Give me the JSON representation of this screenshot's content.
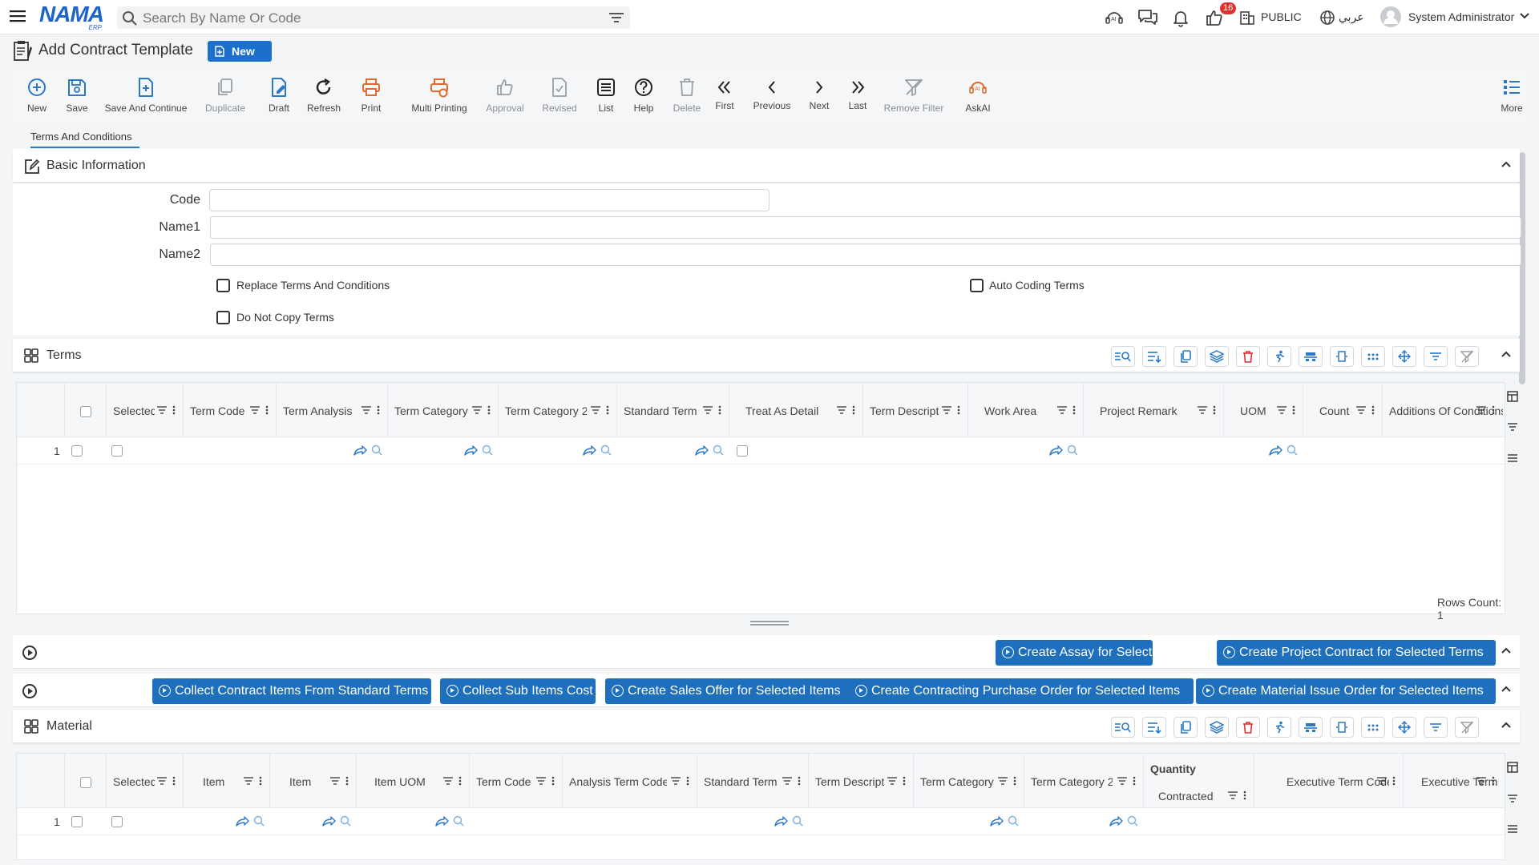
{
  "header": {
    "logo_text": "NAMA",
    "logo_sub": "ERP",
    "search_placeholder": "Search By Name Or Code",
    "notification_count": "16",
    "public_label": "PUBLIC",
    "language_label": "عربي",
    "user_name": "System Administrator"
  },
  "page": {
    "title": "Add Contract Template",
    "status_badge": "New"
  },
  "toolbar": {
    "items": [
      {
        "label": "New",
        "icon": "plus-circle-icon"
      },
      {
        "label": "Save",
        "icon": "save-icon"
      },
      {
        "label": "Save And Continue",
        "icon": "save-continue-icon"
      },
      {
        "label": "Duplicate",
        "icon": "duplicate-icon"
      },
      {
        "label": "Draft",
        "icon": "draft-icon"
      },
      {
        "label": "Refresh",
        "icon": "refresh-icon"
      },
      {
        "label": "Print",
        "icon": "print-icon"
      },
      {
        "label": "Multi Printing",
        "icon": "multi-print-icon"
      },
      {
        "label": "Approval",
        "icon": "thumbs-up-icon"
      },
      {
        "label": "Revised",
        "icon": "revised-icon"
      },
      {
        "label": "List",
        "icon": "list-icon"
      },
      {
        "label": "Help",
        "icon": "help-icon"
      },
      {
        "label": "Delete",
        "icon": "trash-icon"
      },
      {
        "label": "First",
        "icon": "first-icon"
      },
      {
        "label": "Previous",
        "icon": "previous-icon"
      },
      {
        "label": "Next",
        "icon": "next-icon"
      },
      {
        "label": "Last",
        "icon": "last-icon"
      },
      {
        "label": "Remove Filter",
        "icon": "remove-filter-icon"
      },
      {
        "label": "AskAI",
        "icon": "ai-icon"
      },
      {
        "label": "More",
        "icon": "more-icon"
      }
    ]
  },
  "tabs": {
    "active": "Terms And Conditions"
  },
  "basic_info": {
    "title": "Basic Information",
    "code_label": "Code",
    "code_value": "",
    "name1_label": "Name1",
    "name1_value": "",
    "name2_label": "Name2",
    "name2_value": "",
    "replace_terms": "Replace Terms And Conditions",
    "auto_coding": "Auto Coding Terms",
    "do_not_copy": "Do Not Copy Terms"
  },
  "terms": {
    "title": "Terms",
    "columns": [
      "Selected",
      "Term Code",
      "Term Analysis",
      "Term Category",
      "Term Category 2",
      "Standard Term",
      "Treat As Detail",
      "Term Description",
      "Work Area",
      "Project Remark",
      "UOM",
      "Count",
      "Additions Of Conditions"
    ],
    "row_number": "1",
    "rows_count_label": "Rows Count: 1"
  },
  "terms_actions": {
    "create_assay": "Create Assay for Selected Terms",
    "create_project_contract": "Create Project Contract for Selected Terms"
  },
  "item_actions": {
    "collect_contract_items": "Collect Contract Items From Standard Terms",
    "collect_sub_items": "Collect Sub Items Cost",
    "create_sales_offer": "Create Sales Offer for Selected Items",
    "create_purchase_order": "Create Contracting Purchase Order for Selected Items",
    "create_material_issue": "Create Material Issue Order for Selected Items"
  },
  "material": {
    "title": "Material",
    "columns": [
      "Selected",
      "Item",
      "Item",
      "Item UOM",
      "Term Code",
      "Analysis Term Code",
      "Standard Term",
      "Term Description",
      "Term Category",
      "Term Category 2",
      "Contracted",
      "Executive Term Code",
      "Executive Term"
    ],
    "quantity_group": "Quantity",
    "row_number": "1"
  }
}
